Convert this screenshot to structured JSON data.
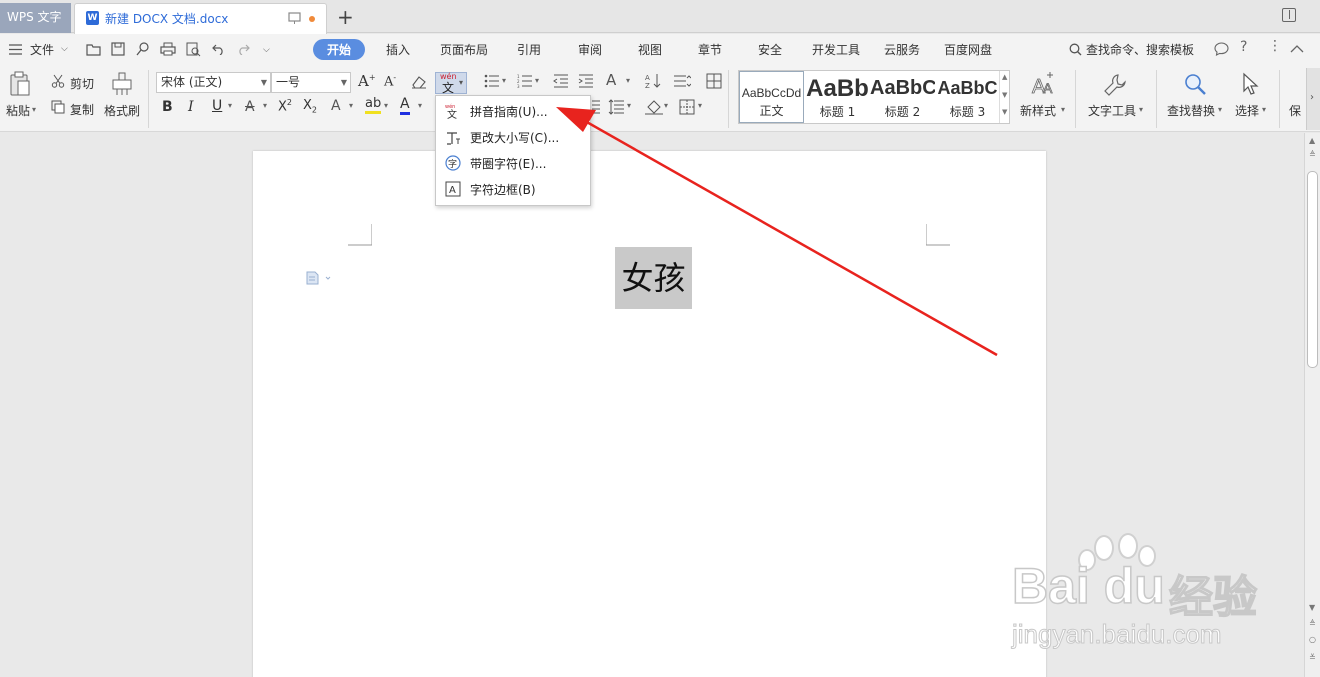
{
  "tabs": {
    "app_tab": "WPS 文字",
    "doc_tab": "新建 DOCX 文档.docx",
    "new_tab_symbol": "+"
  },
  "menu": {
    "file": "文件",
    "items": [
      "开始",
      "插入",
      "页面布局",
      "引用",
      "审阅",
      "视图",
      "章节",
      "安全",
      "开发工具",
      "云服务",
      "百度网盘"
    ],
    "active": "开始",
    "search_placeholder": "查找命令、搜索模板"
  },
  "ribbon": {
    "paste": "粘贴",
    "cut": "剪切",
    "copy": "复制",
    "format_painter": "格式刷",
    "font_name": "宋体 (正文)",
    "font_size": "一号",
    "styles": [
      {
        "preview": "AaBbCcDd",
        "label": "正文"
      },
      {
        "preview": "AaBb",
        "label": "标题 1"
      },
      {
        "preview": "AaBbC",
        "label": "标题 2"
      },
      {
        "preview": "AaBbC",
        "label": "标题 3"
      }
    ],
    "new_style": "新样式",
    "text_tools": "文字工具",
    "find_replace": "查找替换",
    "select": "选择",
    "save_partial": "保"
  },
  "dropdown": {
    "items": [
      {
        "label": "拼音指南(U)...",
        "icon": "pinyin-icon",
        "icon_text": "文"
      },
      {
        "label": "更改大小写(C)...",
        "icon": "change-case-icon",
        "icon_text": "Aa"
      },
      {
        "label": "带圈字符(E)...",
        "icon": "enclosed-char-icon",
        "icon_text": "字"
      },
      {
        "label": "字符边框(B)",
        "icon": "char-border-icon",
        "icon_text": "A"
      }
    ]
  },
  "document": {
    "selected_text": "女孩"
  },
  "watermark": {
    "logo": "Bai du",
    "cn": "经验",
    "url": "jingyan.baidu.com"
  },
  "colors": {
    "accent": "#5a8de0",
    "arrow": "#e8231e",
    "selection": "#c9c9c9"
  }
}
